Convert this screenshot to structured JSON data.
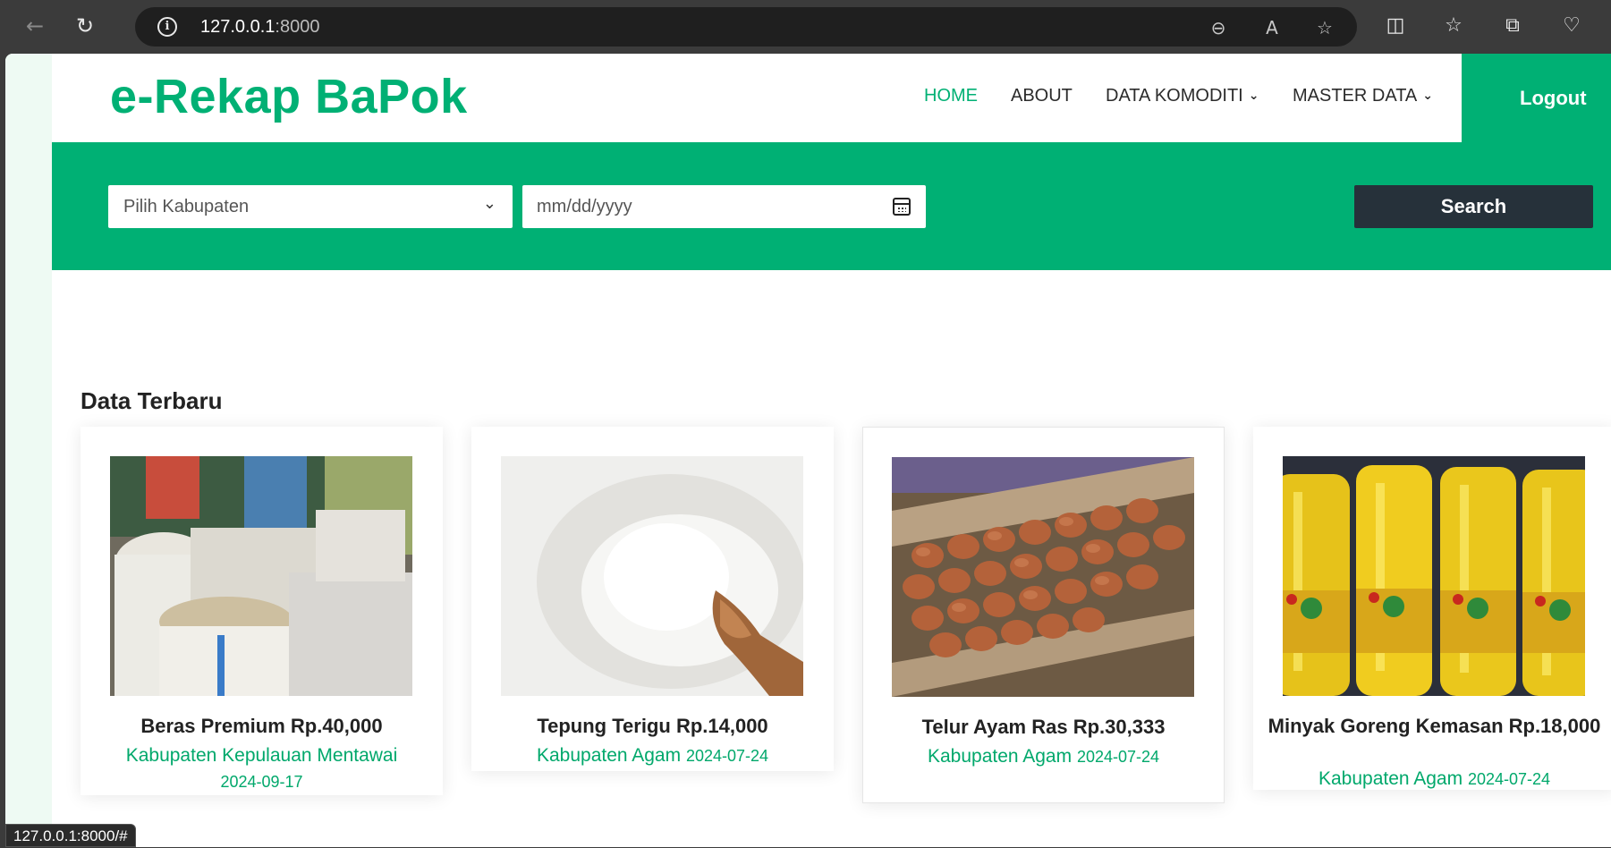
{
  "browser": {
    "url_host": "127.0.0.1",
    "url_port": ":8000",
    "status_url": "127.0.0.1:8000/#"
  },
  "header": {
    "brand": "e-Rekap BaPok",
    "nav": [
      {
        "label": "HOME",
        "active": true
      },
      {
        "label": "ABOUT",
        "active": false
      },
      {
        "label": "DATA KOMODITI",
        "active": false
      },
      {
        "label": "MASTER DATA",
        "active": false
      }
    ],
    "logout_label": "Logout"
  },
  "search": {
    "kabupaten_placeholder": "Pilih Kabupaten",
    "date_placeholder": "mm/dd/yyyy",
    "button_label": "Search"
  },
  "section": {
    "title": "Data Terbaru"
  },
  "cards": [
    {
      "title": "Beras Premium Rp.40,000",
      "location": "Kabupaten Kepulauan Mentawai",
      "date": "2024-09-17",
      "image": "rice-sacks"
    },
    {
      "title": "Tepung Terigu Rp.14,000",
      "location": "Kabupaten Agam",
      "date": "2024-07-24",
      "image": "flour"
    },
    {
      "title": "Telur Ayam Ras Rp.30,333",
      "location": "Kabupaten Agam",
      "date": "2024-07-24",
      "image": "eggs"
    },
    {
      "title": "Minyak Goreng Kemasan Rp.18,000",
      "location": "Kabupaten Agam",
      "date": "2024-07-24",
      "image": "cooking-oil"
    }
  ],
  "colors": {
    "brand_green": "#00b074",
    "dark_button": "#26313a"
  }
}
